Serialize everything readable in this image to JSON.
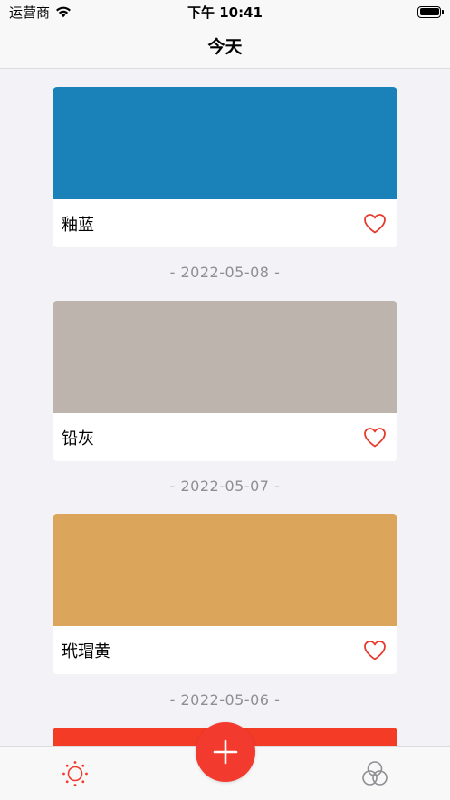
{
  "status_bar": {
    "carrier": "运营商",
    "time": "下午 10:41"
  },
  "nav": {
    "title": "今天"
  },
  "cards": [
    {
      "name": "釉蓝",
      "color": "#1a82b8"
    },
    {
      "name": "铅灰",
      "color": "#bdb5ad"
    },
    {
      "name": "玳瑁黄",
      "color": "#dba65b"
    }
  ],
  "dates": [
    "- 2022-05-08 -",
    "- 2022-05-07 -",
    "- 2022-05-06 -"
  ],
  "partial_card": {
    "color": "#f33b26"
  },
  "tab_bar": {
    "left_icon": "sun-icon",
    "center_icon": "plus-icon",
    "right_icon": "color-circles-icon"
  },
  "colors": {
    "accent": "#f23a2e",
    "heart": "#e63b2e",
    "tab_inactive": "#8e8e93"
  }
}
